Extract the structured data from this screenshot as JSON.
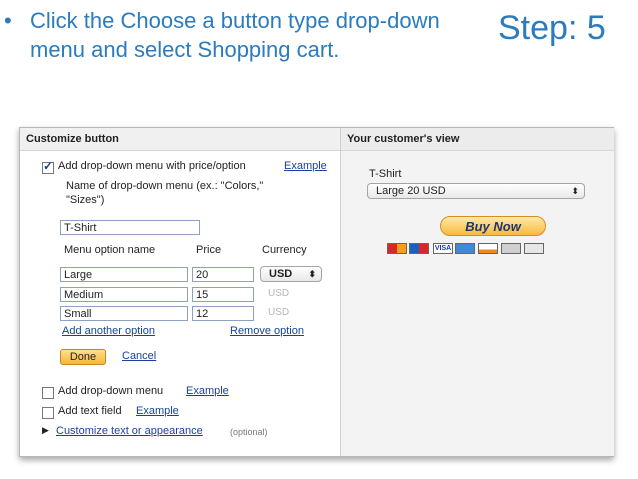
{
  "slide": {
    "bullet_symbol": "•",
    "bullet_text": "Click the Choose a button type drop-down menu and select Shopping cart.",
    "step_label": "Step: 5"
  },
  "customize": {
    "header": "Customize button",
    "dropdown_price_label": "Add drop-down menu with price/option",
    "example_link": "Example",
    "name_label_line1": "Name of drop-down menu (ex.: \"Colors,\"",
    "name_label_line2": "\"Sizes\")",
    "menu_name_value": "T-Shirt",
    "col_option": "Menu option name",
    "col_price": "Price",
    "col_currency": "Currency",
    "options": [
      {
        "name": "Large",
        "price": "20",
        "currency": "USD"
      },
      {
        "name": "Medium",
        "price": "15",
        "currency": "USD"
      },
      {
        "name": "Small",
        "price": "12",
        "currency": "USD"
      }
    ],
    "add_option_link": "Add another option",
    "remove_option_link": "Remove option",
    "done_button": "Done",
    "cancel_link": "Cancel",
    "add_dropdown_label": "Add drop-down menu",
    "add_dropdown_example": "Example",
    "add_text_label": "Add text field",
    "add_text_example": "Example",
    "customize_text_link": "Customize text or appearance",
    "optional_note": "(optional)"
  },
  "preview": {
    "header": "Your customer's view",
    "item_label": "T-Shirt",
    "select_value": "Large 20 USD",
    "buy_button": "Buy Now",
    "cards": [
      "mastercard-icon",
      "maestro-icon",
      "visa-icon",
      "amex-icon",
      "discover-icon",
      "echeck-icon",
      "bank-icon"
    ]
  }
}
